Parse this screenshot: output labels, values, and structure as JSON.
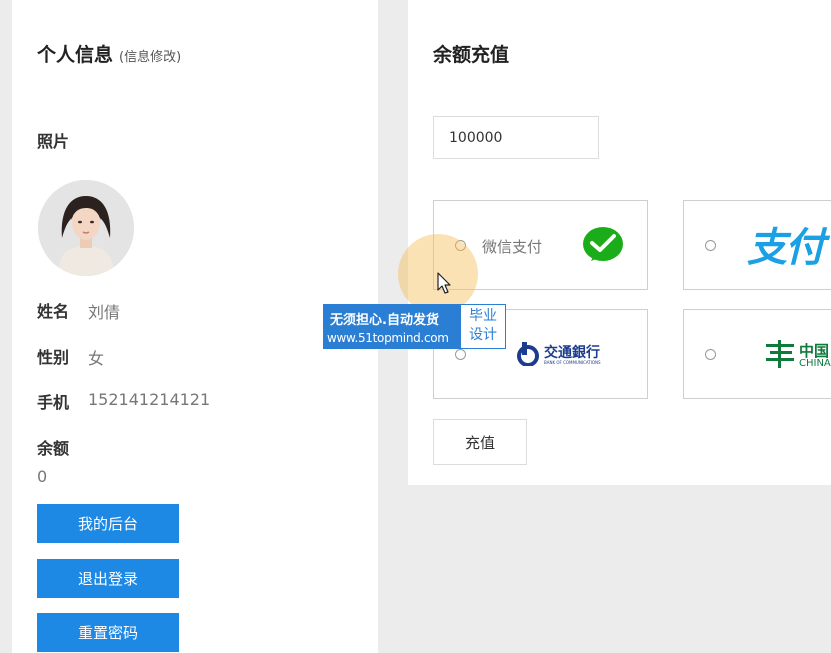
{
  "profile": {
    "title": "个人信息",
    "edit_link": "(信息修改)",
    "photo_label": "照片",
    "name_label": "姓名",
    "name_value": "刘倩",
    "gender_label": "性别",
    "gender_value": "女",
    "phone_label": "手机",
    "phone_value": "152141214121",
    "balance_label": "余额",
    "balance_value": "0",
    "buttons": {
      "dashboard": "我的后台",
      "logout": "退出登录",
      "reset_password": "重置密码"
    }
  },
  "recharge": {
    "title": "余额充值",
    "amount_value": "100000",
    "options": {
      "wechat": "微信支付",
      "alipay_logo": "支付",
      "bocom_cn": "交通銀行",
      "bocom_en": "BANK OF COMMUNICATIONS",
      "postal_cn": "中国",
      "postal_en": "CHINA"
    },
    "submit": "充值"
  },
  "watermark": {
    "line1": "无须担心.自动发货",
    "line2": "www.51topmind.com",
    "side_line1": "毕业",
    "side_line2": "设计"
  },
  "colors": {
    "primary_blue": "#1e88e5",
    "wechat_green": "#1aad19",
    "alipay_blue": "#1aa0e3",
    "bocom_blue": "#1d3c8f",
    "postal_green": "#0f7a3b"
  }
}
